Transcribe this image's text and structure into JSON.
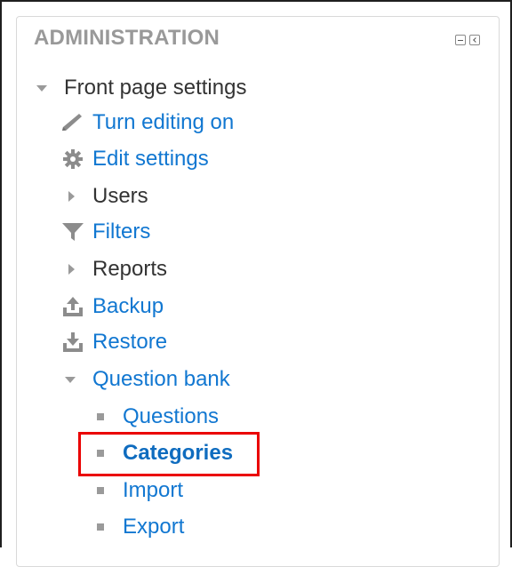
{
  "block": {
    "title": "ADMINISTRATION",
    "controls": {
      "collapse_icon": "collapse-icon",
      "dock_icon": "dock-icon"
    }
  },
  "tree": {
    "front_page_settings": {
      "label": "Front page settings",
      "expander": "caret-down-icon"
    },
    "turn_editing_on": {
      "label": "Turn editing on",
      "icon": "pencil-icon"
    },
    "edit_settings": {
      "label": "Edit settings",
      "icon": "gear-icon"
    },
    "users": {
      "label": "Users",
      "expander": "caret-right-icon"
    },
    "filters": {
      "label": "Filters",
      "icon": "funnel-icon"
    },
    "reports": {
      "label": "Reports",
      "expander": "caret-right-icon"
    },
    "backup": {
      "label": "Backup",
      "icon": "upload-icon"
    },
    "restore": {
      "label": "Restore",
      "icon": "download-icon"
    },
    "question_bank": {
      "label": "Question bank",
      "expander": "caret-down-icon",
      "children": {
        "questions": {
          "label": "Questions"
        },
        "categories": {
          "label": "Categories",
          "highlighted": true
        },
        "import": {
          "label": "Import"
        },
        "export": {
          "label": "Export"
        }
      }
    }
  },
  "colors": {
    "link": "#1177d1",
    "plain_text": "#333333",
    "title": "#999999",
    "highlight_border": "#ea0000"
  }
}
